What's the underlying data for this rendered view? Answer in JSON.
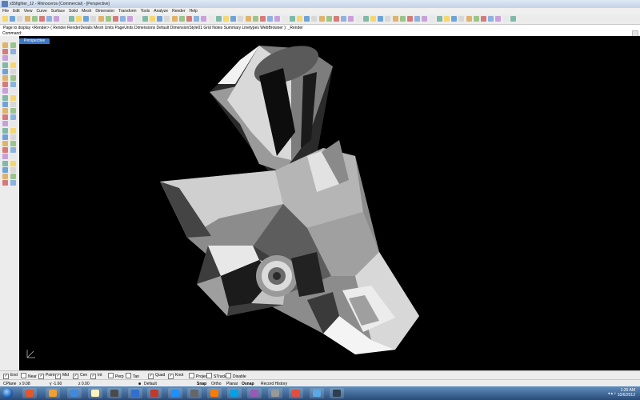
{
  "window": {
    "title": "x55fighter_12 - Rhinoceros (Commercial) - [Perspective]"
  },
  "menu": [
    "File",
    "Edit",
    "View",
    "Curve",
    "Surface",
    "Solid",
    "Mesh",
    "Dimension",
    "Transform",
    "Tools",
    "Analyze",
    "Render",
    "Help"
  ],
  "command_history": "Page to display <Render> ( Render RenderDetails Mesh Units PageUnits Dimensions Default DimensionStyle01 Grid Notes Summary Linetypes WebBrowser ): _Render",
  "command_prompt": "Command:",
  "viewport": {
    "label": "Perspective"
  },
  "osnaps": [
    {
      "label": "End",
      "checked": true
    },
    {
      "label": "Near",
      "checked": false
    },
    {
      "label": "Point",
      "checked": true
    },
    {
      "label": "Mid",
      "checked": true
    },
    {
      "label": "Cen",
      "checked": true
    },
    {
      "label": "Int",
      "checked": true
    },
    {
      "label": "Perp",
      "checked": false
    },
    {
      "label": "Tan",
      "checked": false
    },
    {
      "label": "Quad",
      "checked": true
    },
    {
      "label": "Knot",
      "checked": true
    },
    {
      "label": "Project",
      "checked": false
    },
    {
      "label": "STrack",
      "checked": false
    },
    {
      "label": "Disable",
      "checked": false
    }
  ],
  "status": {
    "cplane": "CPlane",
    "x": "x 9.08",
    "y": "y -1.60",
    "z": "z 0.00",
    "layer": "Default",
    "snap": "Snap",
    "ortho": "Ortho",
    "planar": "Planar",
    "osnap": "Osnap",
    "record_history": "Record History"
  },
  "taskbar": {
    "time": "1:35 AM",
    "date": "10/6/2012"
  },
  "colors": {
    "accent": "#3b78c6",
    "viewport_bg": "#000000",
    "taskbar": "#2a4a77"
  }
}
